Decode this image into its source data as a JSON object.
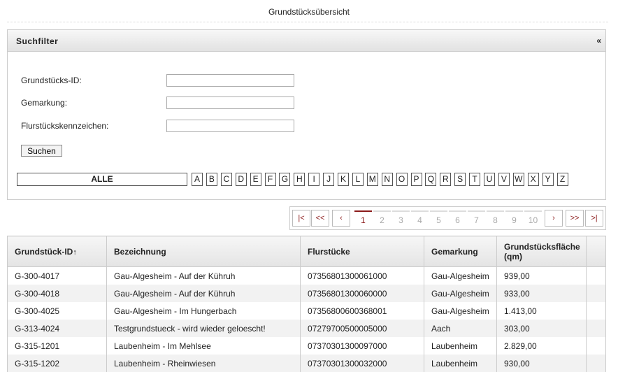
{
  "page": {
    "title": "Grundstücksübersicht"
  },
  "filter": {
    "title": "Suchfilter",
    "collapse_label": "«",
    "fields": [
      {
        "label": "Grundstücks-ID:",
        "value": ""
      },
      {
        "label": "Gemarkung:",
        "value": ""
      },
      {
        "label": "Flurstückskennzeichen:",
        "value": ""
      }
    ],
    "search_label": "Suchen",
    "all_label": "ALLE",
    "letters": [
      "A",
      "B",
      "C",
      "D",
      "E",
      "F",
      "G",
      "H",
      "I",
      "J",
      "K",
      "L",
      "M",
      "N",
      "O",
      "P",
      "Q",
      "R",
      "S",
      "T",
      "U",
      "V",
      "W",
      "X",
      "Y",
      "Z"
    ]
  },
  "pager": {
    "first": "|<",
    "prev_block": "<<",
    "prev": "‹",
    "pages": [
      "1",
      "2",
      "3",
      "4",
      "5",
      "6",
      "7",
      "8",
      "9",
      "10"
    ],
    "active_page": "1",
    "next": "›",
    "next_block": ">>",
    "last": ">|"
  },
  "table": {
    "columns": [
      {
        "label": "Grundstück-ID",
        "sort_indicator": "↑"
      },
      {
        "label": "Bezeichnung"
      },
      {
        "label": "Flurstücke"
      },
      {
        "label": "Gemarkung"
      },
      {
        "label": "Grundstücksfläche (qm)"
      },
      {
        "label": ""
      }
    ],
    "rows": [
      [
        "G-300-4017",
        "Gau-Algesheim - Auf der Kühruh",
        "07356801300061000",
        "Gau-Algesheim",
        "939,00"
      ],
      [
        "G-300-4018",
        "Gau-Algesheim - Auf der Kühruh",
        "07356801300060000",
        "Gau-Algesheim",
        "933,00"
      ],
      [
        "G-300-4025",
        "Gau-Algesheim - Im Hungerbach",
        "07356800600368001",
        "Gau-Algesheim",
        "1.413,00"
      ],
      [
        "G-313-4024",
        "Testgrundstueck - wird wieder geloescht!",
        "07279700500005000",
        "Aach",
        "303,00"
      ],
      [
        "G-315-1201",
        "Laubenheim - Im Mehlsee",
        "07370301300097000",
        "Laubenheim",
        "2.829,00"
      ],
      [
        "G-315-1202",
        "Laubenheim - Rheinwiesen",
        "07370301300032000",
        "Laubenheim",
        "930,00"
      ]
    ]
  }
}
